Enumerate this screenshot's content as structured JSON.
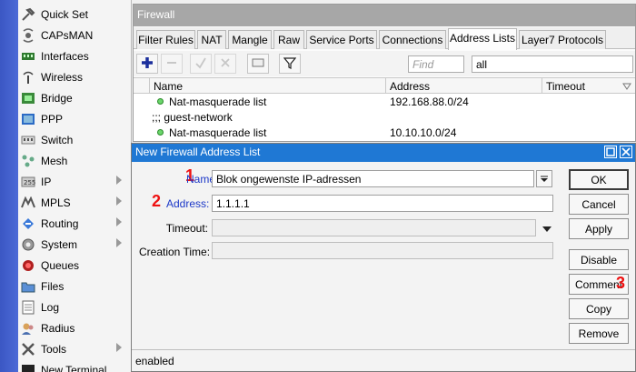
{
  "sidebar": {
    "items": [
      {
        "label": "Quick Set",
        "icon": "quickset-icon",
        "submenu": false
      },
      {
        "label": "CAPsMAN",
        "icon": "capsman-icon",
        "submenu": false
      },
      {
        "label": "Interfaces",
        "icon": "interfaces-icon",
        "submenu": false
      },
      {
        "label": "Wireless",
        "icon": "wireless-icon",
        "submenu": false
      },
      {
        "label": "Bridge",
        "icon": "bridge-icon",
        "submenu": false
      },
      {
        "label": "PPP",
        "icon": "ppp-icon",
        "submenu": false
      },
      {
        "label": "Switch",
        "icon": "switch-icon",
        "submenu": false
      },
      {
        "label": "Mesh",
        "icon": "mesh-icon",
        "submenu": false
      },
      {
        "label": "IP",
        "icon": "ip-icon",
        "submenu": true
      },
      {
        "label": "MPLS",
        "icon": "mpls-icon",
        "submenu": true
      },
      {
        "label": "Routing",
        "icon": "routing-icon",
        "submenu": true
      },
      {
        "label": "System",
        "icon": "system-icon",
        "submenu": true
      },
      {
        "label": "Queues",
        "icon": "queues-icon",
        "submenu": false
      },
      {
        "label": "Files",
        "icon": "files-icon",
        "submenu": false
      },
      {
        "label": "Log",
        "icon": "log-icon",
        "submenu": false
      },
      {
        "label": "Radius",
        "icon": "radius-icon",
        "submenu": false
      },
      {
        "label": "Tools",
        "icon": "tools-icon",
        "submenu": true
      },
      {
        "label": "New Terminal",
        "icon": "terminal-icon",
        "submenu": false
      }
    ]
  },
  "firewall": {
    "title": "Firewall",
    "tabs": [
      "Filter Rules",
      "NAT",
      "Mangle",
      "Raw",
      "Service Ports",
      "Connections",
      "Address Lists",
      "Layer7 Protocols"
    ],
    "active_tab": "Address Lists",
    "find_placeholder": "Find",
    "filter_value": "all",
    "columns": [
      "Name",
      "Address",
      "Timeout"
    ],
    "rows": [
      {
        "type": "entry",
        "name": "Nat-masquerade list",
        "address": "192.168.88.0/24"
      },
      {
        "type": "comment",
        "text": ";;; guest-network"
      },
      {
        "type": "entry",
        "name": "Nat-masquerade list",
        "address": "10.10.10.0/24"
      }
    ]
  },
  "dialog": {
    "title": "New Firewall Address List",
    "fields": {
      "name": {
        "label": "Name:",
        "value": "Blok ongewenste IP-adressen",
        "marker": "1"
      },
      "address": {
        "label": "Address:",
        "value": "1.1.1.1",
        "marker": "2"
      },
      "timeout": {
        "label": "Timeout:",
        "value": ""
      },
      "creation_time": {
        "label": "Creation Time:",
        "value": ""
      }
    },
    "buttons": {
      "ok": "OK",
      "cancel": "Cancel",
      "apply": "Apply",
      "disable": "Disable",
      "comment": "Comment",
      "copy": "Copy",
      "remove": "Remove"
    },
    "comment_marker": "3",
    "status": "enabled"
  },
  "colors": {
    "sidebar_strip": "#3b57c4",
    "dialog_title": "#1f78d4",
    "marker": "#e11111",
    "field_label_blue": "#1c38c8"
  }
}
